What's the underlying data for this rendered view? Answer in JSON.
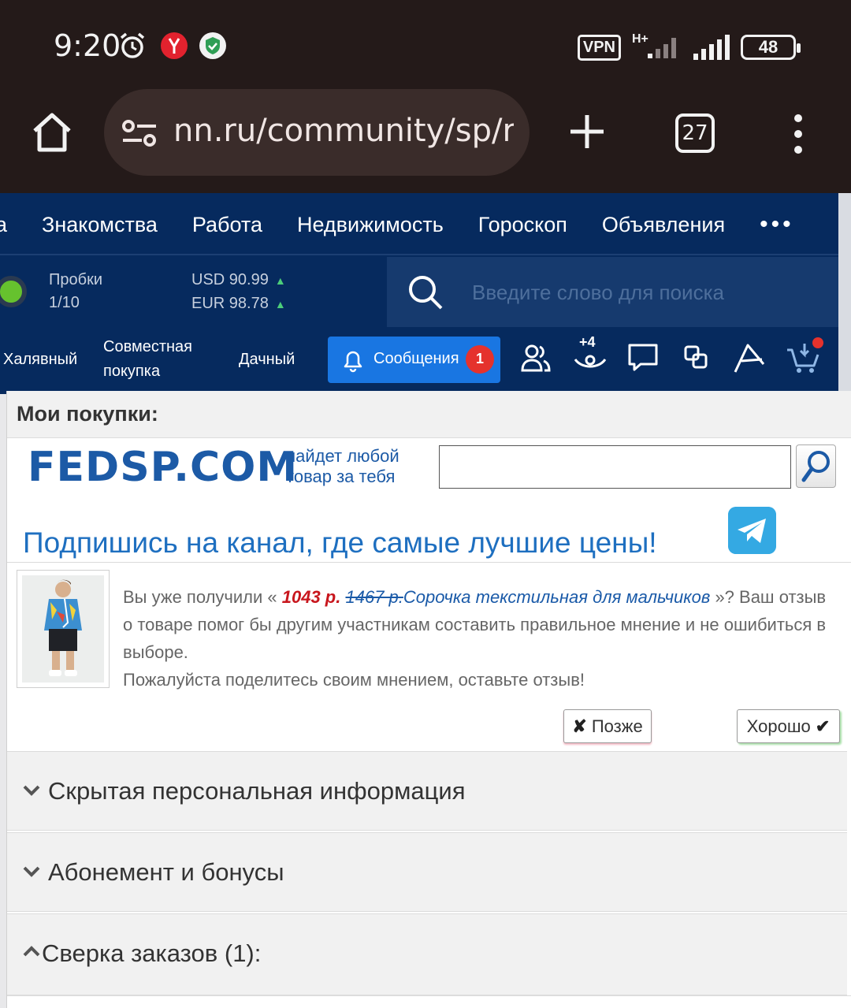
{
  "status_bar": {
    "time": "9:20",
    "icons": [
      "alarm-icon",
      "yandex-icon",
      "shield-check-icon"
    ],
    "vpn": "VPN",
    "network": "H+",
    "battery": "48"
  },
  "browser": {
    "url": "nn.ru/community/sp/r",
    "tab_count": "27"
  },
  "site_nav": {
    "items": [
      "а",
      "Знакомства",
      "Работа",
      "Недвижимость",
      "Гороскоп",
      "Объявления"
    ],
    "more": "•••"
  },
  "info": {
    "traffic_label": "Пробки",
    "traffic_value": "1/10",
    "usd": "USD 90.99",
    "eur": "EUR 98.78",
    "search_placeholder": "Введите слово для поиска"
  },
  "sub_nav": {
    "item1": "Халявный",
    "item2_line1": "Совместная",
    "item2_line2": "покупка",
    "item3": "Дачный",
    "messages_label": "Сообщения",
    "messages_count": "1",
    "views_badge": "+4"
  },
  "panel": {
    "title": "Мои покупки:",
    "logo": "FEDSP.COM",
    "slogan_line1": "найдет любой",
    "slogan_line2": "товар за тебя",
    "search_value": "",
    "promo": "Подпишись на канал, где самые лучшие цены!",
    "review": {
      "prefix": "Вы уже получили « ",
      "price_now": "1043 р.",
      "price_old": "1467 р.",
      "product": "Сорочка текстильная для мальчиков",
      "suffix": " »? Ваш отзыв о товаре помог бы другим участникам составить правильное мнение и не ошибиться в выборе.",
      "request": "Пожалуйста поделитесь своим мнением, оставьте отзыв!"
    },
    "btn_later": "Позже",
    "btn_ok": "Хорошо",
    "sections": [
      {
        "label": "Скрытая персональная информация",
        "state": "collapsed"
      },
      {
        "label": "Абонемент и бонусы",
        "state": "collapsed"
      },
      {
        "label": "Сверка заказов (1):",
        "state": "expanded"
      }
    ]
  },
  "colors": {
    "chrome_bg": "#241a19",
    "site_nav_bg": "#062a5e",
    "messages_button": "#1976e2",
    "badge_red": "#e5322d",
    "logo_blue": "#1c5aa6",
    "promo_blue": "#1e6fc0",
    "telegram": "#34a9e3"
  }
}
